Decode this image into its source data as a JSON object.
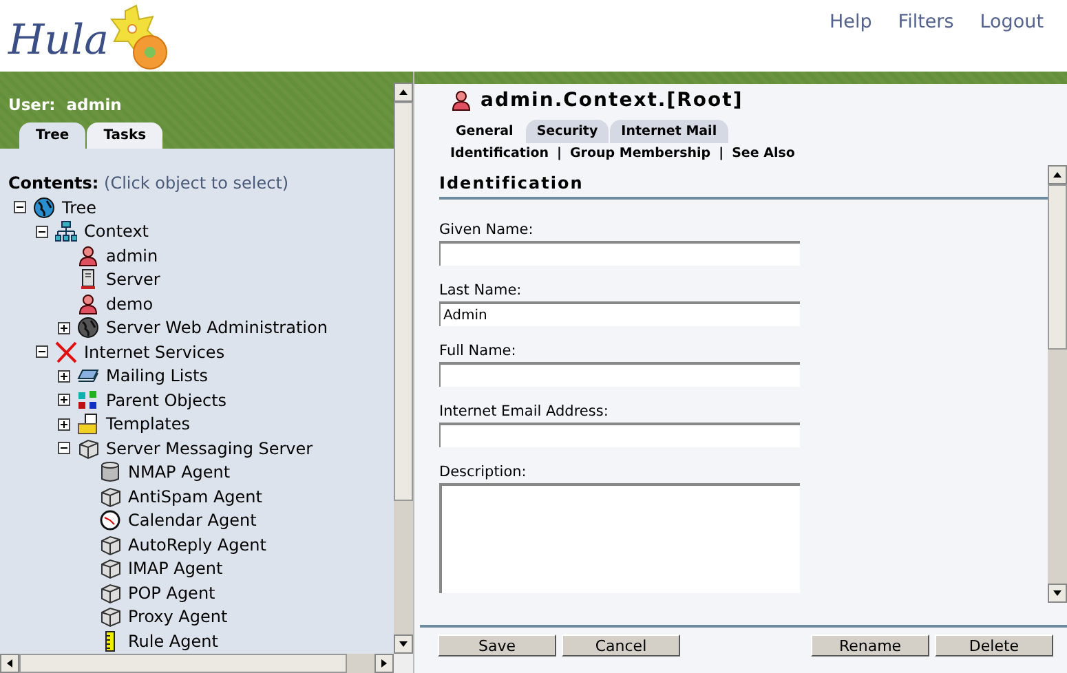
{
  "header": {
    "logo": "Hula",
    "links": [
      "Help",
      "Filters",
      "Logout"
    ]
  },
  "sidebar": {
    "user_label": "User:",
    "user": "admin",
    "tabs": [
      {
        "label": "Tree",
        "selected": true
      },
      {
        "label": "Tasks",
        "selected": false
      }
    ],
    "contents_label": "Contents:",
    "contents_hint": "(Click object to select)",
    "tree": [
      {
        "label": "Tree",
        "kind": "globe",
        "expanded": true,
        "children": [
          {
            "label": "Context",
            "kind": "network",
            "expanded": true,
            "children": [
              {
                "label": "admin",
                "kind": "user"
              },
              {
                "label": "Server",
                "kind": "server"
              },
              {
                "label": "demo",
                "kind": "user"
              },
              {
                "label": "Server Web Administration",
                "kind": "darkglobe",
                "expanded": false
              }
            ]
          },
          {
            "label": "Internet Services",
            "kind": "cross",
            "expanded": true,
            "children": [
              {
                "label": "Mailing Lists",
                "kind": "stack",
                "expanded": false
              },
              {
                "label": "Parent Objects",
                "kind": "blocks",
                "expanded": false
              },
              {
                "label": "Templates",
                "kind": "folder",
                "expanded": false
              },
              {
                "label": "Server Messaging Server",
                "kind": "box",
                "expanded": true,
                "children": [
                  {
                    "label": "NMAP Agent",
                    "kind": "cylinder"
                  },
                  {
                    "label": "AntiSpam Agent",
                    "kind": "box"
                  },
                  {
                    "label": "Calendar Agent",
                    "kind": "clock"
                  },
                  {
                    "label": "AutoReply Agent",
                    "kind": "box"
                  },
                  {
                    "label": "IMAP Agent",
                    "kind": "box"
                  },
                  {
                    "label": "POP Agent",
                    "kind": "box"
                  },
                  {
                    "label": "Proxy Agent",
                    "kind": "box"
                  },
                  {
                    "label": "Rule Agent",
                    "kind": "ruler"
                  }
                ]
              }
            ]
          }
        ]
      }
    ]
  },
  "object": {
    "title": "admin.Context.[Root]",
    "tabs": [
      {
        "label": "General",
        "selected": true
      },
      {
        "label": "Security",
        "selected": false
      },
      {
        "label": "Internet Mail",
        "selected": false
      }
    ],
    "subnav": [
      "Identification",
      "Group Membership",
      "See Also"
    ],
    "subnav_separator": "|",
    "section": "Identification",
    "fields": [
      {
        "label": "Given Name:",
        "kind": "text"
      },
      {
        "label": "Last Name:",
        "kind": "text",
        "value": "Admin"
      },
      {
        "label": "Full Name:",
        "kind": "text"
      },
      {
        "label": "Internet Email Address:",
        "kind": "text"
      },
      {
        "label": "Description:",
        "kind": "textarea"
      }
    ],
    "buttons_left": [
      "Save",
      "Cancel"
    ],
    "buttons_right": [
      "Rename",
      "Delete"
    ]
  }
}
